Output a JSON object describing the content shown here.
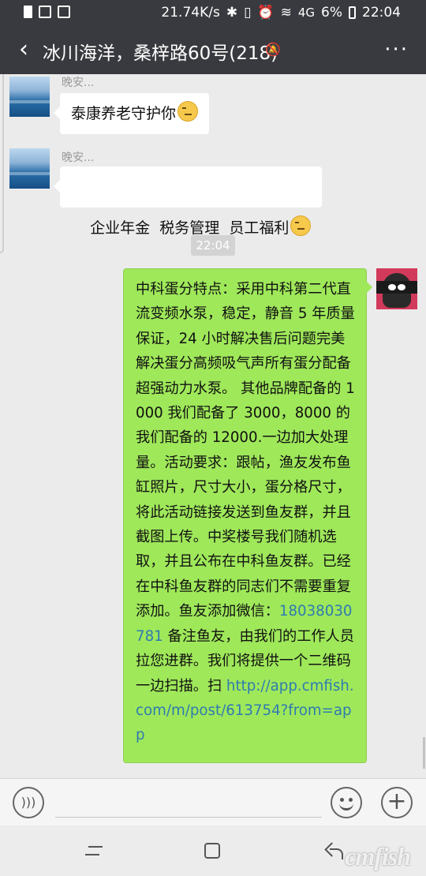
{
  "status_bar": {
    "speed": "21.74K/s",
    "network": "4G",
    "battery": "6%",
    "time": "22:04"
  },
  "header": {
    "title": "冰川海洋，桑梓路60号(218)",
    "back_icon": "back-arrow-icon",
    "more_label": "···"
  },
  "messages": [
    {
      "sender": "晚安...",
      "text": "泰康养老守护你",
      "emoji": "smirk-emoji"
    },
    {
      "sender": "晚安...",
      "text": "企业年金  税务管理  员工福利",
      "emoji": "smirk-emoji"
    }
  ],
  "time_divider": "22:04",
  "my_message": {
    "text_a": "中科蛋分特点：采用中科第二代直流变频水泵，稳定，静音 5 年质量保证，24 小时解决售后问题完美解决蛋分高频吸气声所有蛋分配备超强动力水泵。 其他品牌配备的 1000 我们配备了 3000，8000 的我们配备的 12000.一边加大处理量。活动要求：跟帖，渔友发布鱼缸照片，尺寸大小，蛋分格尺寸，将此活动链接发送到鱼友群，并且截图上传。中奖楼号我们随机选取，并且公布在中科鱼友群。已经在中科鱼友群的同志们不需要重复添加。鱼友添加微信：",
    "phone": "18038030781",
    "text_b": " 备注鱼友，由我们的工作人员拉您进群。我们将提供一个二维码一边扫描。扫 ",
    "url": "http://app.cmfish.com/m/post/613754?from=app"
  },
  "input_bar": {
    "voice_icon": "voice-icon",
    "emoji_icon": "emoji-icon",
    "plus_icon": "plus-icon"
  },
  "watermark": "cmfish"
}
